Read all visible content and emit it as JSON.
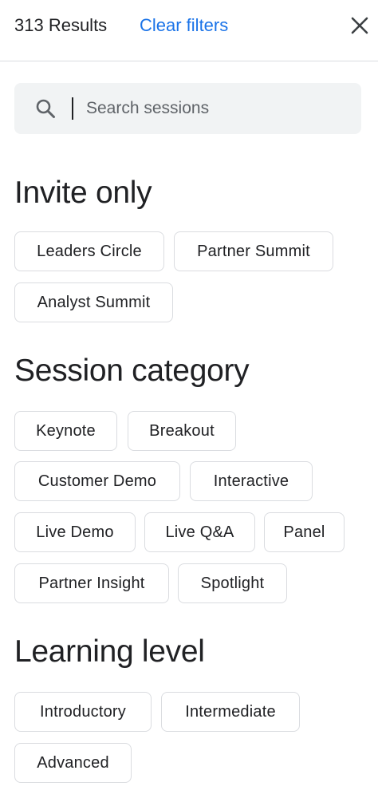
{
  "header": {
    "results_count": "313 Results",
    "clear_filters_label": "Clear filters",
    "close_icon": "close-icon"
  },
  "search": {
    "placeholder": "Search sessions",
    "value": "",
    "icon": "search-icon"
  },
  "sections": {
    "invite_only": {
      "title": "Invite only",
      "chips": [
        "Leaders Circle",
        "Partner Summit",
        "Analyst Summit"
      ]
    },
    "session_category": {
      "title": "Session category",
      "chips": [
        "Keynote",
        "Breakout",
        "Customer Demo",
        "Interactive",
        "Live Demo",
        "Live Q&A",
        "Panel",
        "Partner Insight",
        "Spotlight"
      ]
    },
    "learning_level": {
      "title": "Learning level",
      "chips": [
        "Introductory",
        "Intermediate",
        "Advanced"
      ]
    }
  },
  "colors": {
    "link": "#1a73e8",
    "text": "#202124",
    "chip_border": "#dadce0",
    "search_bg": "#f1f3f4"
  }
}
